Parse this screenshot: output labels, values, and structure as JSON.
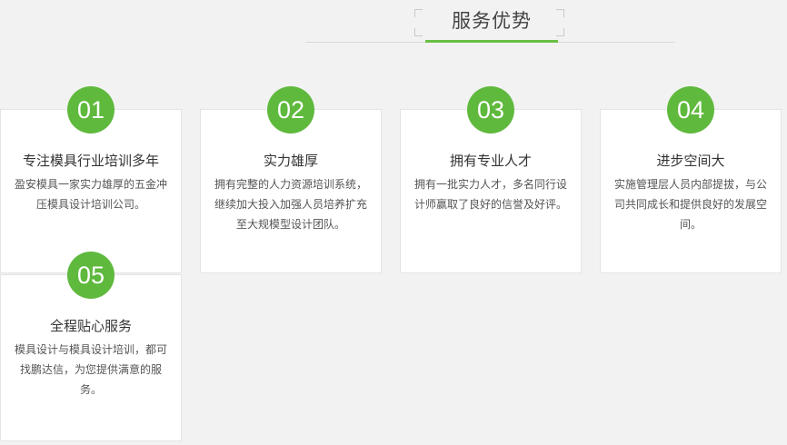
{
  "header": {
    "title": "服务优势"
  },
  "cards": [
    {
      "number": "01",
      "title": "专注模具行业培训多年",
      "desc": "盈安模具一家实力雄厚的五金冲压模具设计培训公司。"
    },
    {
      "number": "02",
      "title": "实力雄厚",
      "desc": "拥有完整的人力资源培训系统，继续加大投入加强人员培养扩充至大规模型设计团队。"
    },
    {
      "number": "03",
      "title": "拥有专业人才",
      "desc": "拥有一批实力人才，多名同行设计师赢取了良好的信誉及好评。"
    },
    {
      "number": "04",
      "title": "进步空间大",
      "desc": "实施管理层人员内部提拔，与公司共同成长和提供良好的发展空间。"
    },
    {
      "number": "05",
      "title": "全程贴心服务",
      "desc": "模具设计与模具设计培训，都可找鹏达信，为您提供满意的服务。"
    }
  ],
  "colors": {
    "accent": "#5fb93d",
    "background": "#f2f2f2",
    "card": "#ffffff"
  }
}
